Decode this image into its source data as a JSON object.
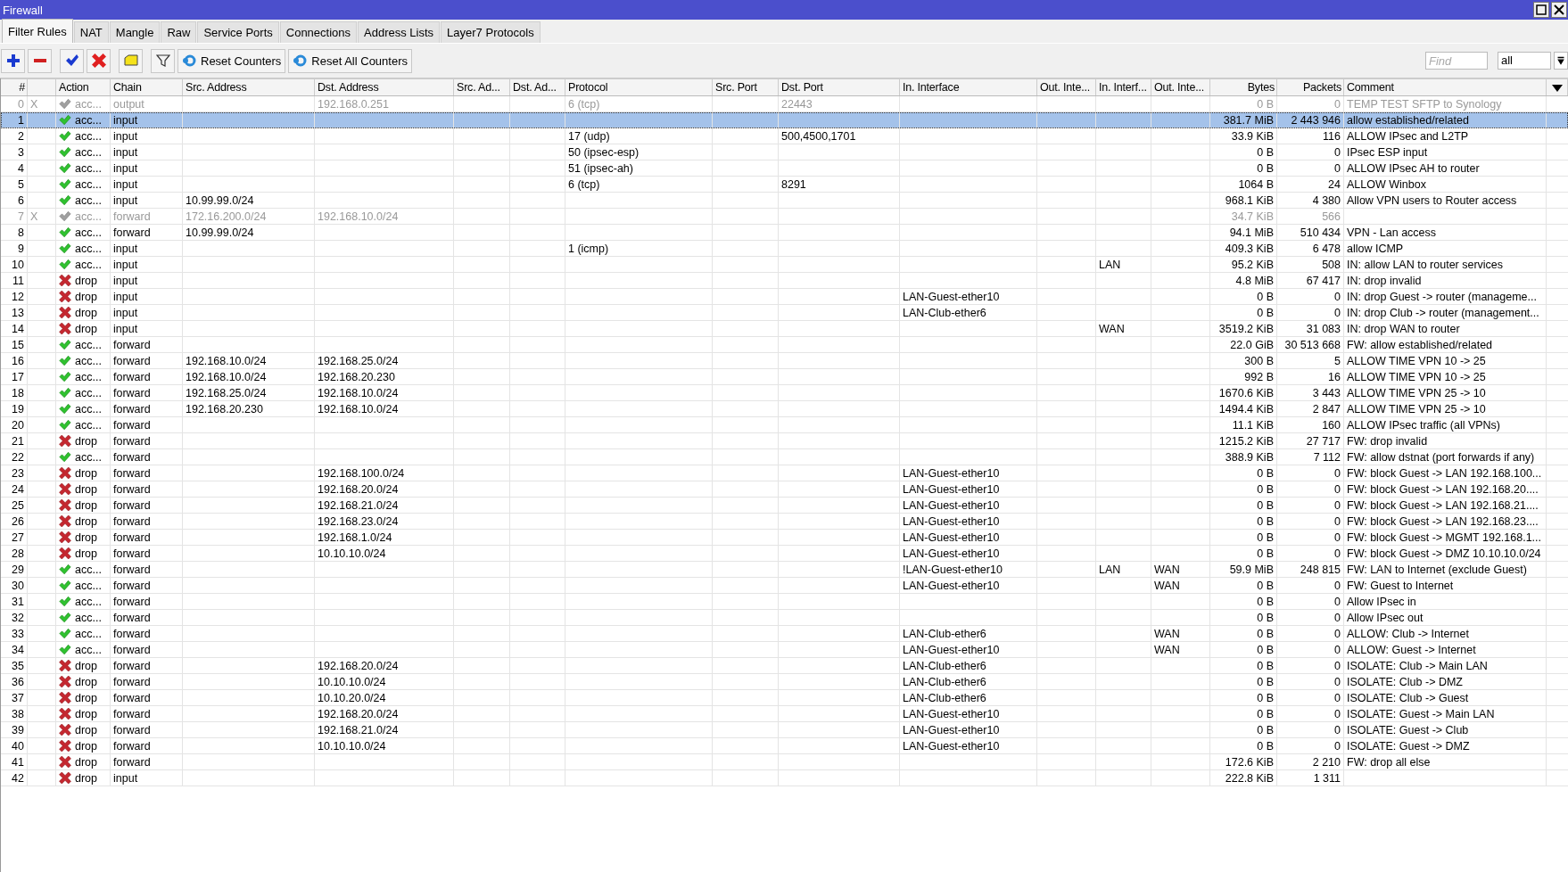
{
  "window": {
    "title": "Firewall"
  },
  "tabs": [
    {
      "label": "Filter Rules",
      "selected": true
    },
    {
      "label": "NAT",
      "selected": false
    },
    {
      "label": "Mangle",
      "selected": false
    },
    {
      "label": "Raw",
      "selected": false
    },
    {
      "label": "Service Ports",
      "selected": false
    },
    {
      "label": "Connections",
      "selected": false
    },
    {
      "label": "Address Lists",
      "selected": false
    },
    {
      "label": "Layer7 Protocols",
      "selected": false
    }
  ],
  "toolbar": {
    "buttons": [
      "Reset Counters",
      "Reset All Counters"
    ],
    "find": {
      "placeholder": "Find"
    },
    "filter_select": "all"
  },
  "table": {
    "columns": [
      "#",
      "",
      "Action",
      "Chain",
      "Src. Address",
      "Dst. Address",
      "Src. Ad...",
      "Dst. Ad...",
      "Protocol",
      "Src. Port",
      "Dst. Port",
      "In. Interface",
      "Out. Inte...",
      "In. Interf...",
      "Out. Inte...",
      "Bytes",
      "Packets",
      "Comment"
    ],
    "rows": [
      {
        "num": "0",
        "flag": "X",
        "disabled": true,
        "selected": false,
        "kind": "accept",
        "action": "acc...",
        "chain": "output",
        "dst_address": "192.168.0.251",
        "protocol": "6 (tcp)",
        "dst_port": "22443",
        "bytes": "0 B",
        "packets": "0",
        "comment": "TEMP TEST SFTP to Synology"
      },
      {
        "num": "1",
        "disabled": false,
        "selected": true,
        "kind": "accept",
        "action": "acc...",
        "chain": "input",
        "bytes": "381.7 MiB",
        "packets": "2 443 946",
        "comment": "allow established/related"
      },
      {
        "num": "2",
        "disabled": false,
        "selected": false,
        "kind": "accept",
        "action": "acc...",
        "chain": "input",
        "protocol": "17 (udp)",
        "dst_port": "500,4500,1701",
        "bytes": "33.9 KiB",
        "packets": "116",
        "comment": "ALLOW IPsec and L2TP"
      },
      {
        "num": "3",
        "disabled": false,
        "selected": false,
        "kind": "accept",
        "action": "acc...",
        "chain": "input",
        "protocol": "50 (ipsec-esp)",
        "bytes": "0 B",
        "packets": "0",
        "comment": "IPsec ESP input"
      },
      {
        "num": "4",
        "disabled": false,
        "selected": false,
        "kind": "accept",
        "action": "acc...",
        "chain": "input",
        "protocol": "51 (ipsec-ah)",
        "bytes": "0 B",
        "packets": "0",
        "comment": "ALLOW IPsec AH to router"
      },
      {
        "num": "5",
        "disabled": false,
        "selected": false,
        "kind": "accept",
        "action": "acc...",
        "chain": "input",
        "protocol": "6 (tcp)",
        "dst_port": "8291",
        "bytes": "1064 B",
        "packets": "24",
        "comment": "ALLOW Winbox"
      },
      {
        "num": "6",
        "disabled": false,
        "selected": false,
        "kind": "accept",
        "action": "acc...",
        "chain": "input",
        "src_address": "10.99.99.0/24",
        "bytes": "968.1 KiB",
        "packets": "4 380",
        "comment": "Allow VPN users to Router access"
      },
      {
        "num": "7",
        "flag": "X",
        "disabled": true,
        "selected": false,
        "kind": "accept",
        "action": "acc...",
        "chain": "forward",
        "src_address": "172.16.200.0/24",
        "dst_address": "192.168.10.0/24",
        "bytes": "34.7 KiB",
        "packets": "566"
      },
      {
        "num": "8",
        "disabled": false,
        "selected": false,
        "kind": "accept",
        "action": "acc...",
        "chain": "forward",
        "src_address": "10.99.99.0/24",
        "bytes": "94.1 MiB",
        "packets": "510 434",
        "comment": "VPN - Lan access"
      },
      {
        "num": "9",
        "disabled": false,
        "selected": false,
        "kind": "accept",
        "action": "acc...",
        "chain": "input",
        "protocol": "1 (icmp)",
        "bytes": "409.3 KiB",
        "packets": "6 478",
        "comment": "allow ICMP"
      },
      {
        "num": "10",
        "disabled": false,
        "selected": false,
        "kind": "accept",
        "action": "acc...",
        "chain": "input",
        "in_interface_list": "LAN",
        "bytes": "95.2 KiB",
        "packets": "508",
        "comment": "IN: allow LAN to router services"
      },
      {
        "num": "11",
        "disabled": false,
        "selected": false,
        "kind": "drop",
        "action": "drop",
        "chain": "input",
        "bytes": "4.8 MiB",
        "packets": "67 417",
        "comment": "IN: drop invalid"
      },
      {
        "num": "12",
        "disabled": false,
        "selected": false,
        "kind": "drop",
        "action": "drop",
        "chain": "input",
        "in_interface": "LAN-Guest-ether10",
        "bytes": "0 B",
        "packets": "0",
        "comment": "IN: drop Guest -> router (manageme..."
      },
      {
        "num": "13",
        "disabled": false,
        "selected": false,
        "kind": "drop",
        "action": "drop",
        "chain": "input",
        "in_interface": "LAN-Club-ether6",
        "bytes": "0 B",
        "packets": "0",
        "comment": "IN: drop Club -> router (management..."
      },
      {
        "num": "14",
        "disabled": false,
        "selected": false,
        "kind": "drop",
        "action": "drop",
        "chain": "input",
        "in_interface_list": "WAN",
        "bytes": "3519.2 KiB",
        "packets": "31 083",
        "comment": "IN: drop WAN to router"
      },
      {
        "num": "15",
        "disabled": false,
        "selected": false,
        "kind": "accept",
        "action": "acc...",
        "chain": "forward",
        "bytes": "22.0 GiB",
        "packets": "30 513 668",
        "comment": "FW: allow established/related"
      },
      {
        "num": "16",
        "disabled": false,
        "selected": false,
        "kind": "accept",
        "action": "acc...",
        "chain": "forward",
        "src_address": "192.168.10.0/24",
        "dst_address": "192.168.25.0/24",
        "bytes": "300 B",
        "packets": "5",
        "comment": "ALLOW TIME VPN 10 -> 25"
      },
      {
        "num": "17",
        "disabled": false,
        "selected": false,
        "kind": "accept",
        "action": "acc...",
        "chain": "forward",
        "src_address": "192.168.10.0/24",
        "dst_address": "192.168.20.230",
        "bytes": "992 B",
        "packets": "16",
        "comment": "ALLOW TIME VPN 10 -> 25"
      },
      {
        "num": "18",
        "disabled": false,
        "selected": false,
        "kind": "accept",
        "action": "acc...",
        "chain": "forward",
        "src_address": "192.168.25.0/24",
        "dst_address": "192.168.10.0/24",
        "bytes": "1670.6 KiB",
        "packets": "3 443",
        "comment": "ALLOW TIME VPN 25 -> 10"
      },
      {
        "num": "19",
        "disabled": false,
        "selected": false,
        "kind": "accept",
        "action": "acc...",
        "chain": "forward",
        "src_address": "192.168.20.230",
        "dst_address": "192.168.10.0/24",
        "bytes": "1494.4 KiB",
        "packets": "2 847",
        "comment": "ALLOW TIME VPN 25 -> 10"
      },
      {
        "num": "20",
        "disabled": false,
        "selected": false,
        "kind": "accept",
        "action": "acc...",
        "chain": "forward",
        "bytes": "11.1 KiB",
        "packets": "160",
        "comment": "ALLOW IPsec traffic (all VPNs)"
      },
      {
        "num": "21",
        "disabled": false,
        "selected": false,
        "kind": "drop",
        "action": "drop",
        "chain": "forward",
        "bytes": "1215.2 KiB",
        "packets": "27 717",
        "comment": "FW: drop invalid"
      },
      {
        "num": "22",
        "disabled": false,
        "selected": false,
        "kind": "accept",
        "action": "acc...",
        "chain": "forward",
        "bytes": "388.9 KiB",
        "packets": "7 112",
        "comment": "FW: allow dstnat (port forwards if any)"
      },
      {
        "num": "23",
        "disabled": false,
        "selected": false,
        "kind": "drop",
        "action": "drop",
        "chain": "forward",
        "dst_address": "192.168.100.0/24",
        "in_interface": "LAN-Guest-ether10",
        "bytes": "0 B",
        "packets": "0",
        "comment": "FW: block Guest -> LAN 192.168.100..."
      },
      {
        "num": "24",
        "disabled": false,
        "selected": false,
        "kind": "drop",
        "action": "drop",
        "chain": "forward",
        "dst_address": "192.168.20.0/24",
        "in_interface": "LAN-Guest-ether10",
        "bytes": "0 B",
        "packets": "0",
        "comment": "FW: block Guest -> LAN 192.168.20...."
      },
      {
        "num": "25",
        "disabled": false,
        "selected": false,
        "kind": "drop",
        "action": "drop",
        "chain": "forward",
        "dst_address": "192.168.21.0/24",
        "in_interface": "LAN-Guest-ether10",
        "bytes": "0 B",
        "packets": "0",
        "comment": "FW: block Guest -> LAN 192.168.21...."
      },
      {
        "num": "26",
        "disabled": false,
        "selected": false,
        "kind": "drop",
        "action": "drop",
        "chain": "forward",
        "dst_address": "192.168.23.0/24",
        "in_interface": "LAN-Guest-ether10",
        "bytes": "0 B",
        "packets": "0",
        "comment": "FW: block Guest -> LAN 192.168.23...."
      },
      {
        "num": "27",
        "disabled": false,
        "selected": false,
        "kind": "drop",
        "action": "drop",
        "chain": "forward",
        "dst_address": "192.168.1.0/24",
        "in_interface": "LAN-Guest-ether10",
        "bytes": "0 B",
        "packets": "0",
        "comment": "FW: block Guest -> MGMT 192.168.1..."
      },
      {
        "num": "28",
        "disabled": false,
        "selected": false,
        "kind": "drop",
        "action": "drop",
        "chain": "forward",
        "dst_address": "10.10.10.0/24",
        "in_interface": "LAN-Guest-ether10",
        "bytes": "0 B",
        "packets": "0",
        "comment": "FW: block Guest -> DMZ 10.10.10.0/24"
      },
      {
        "num": "29",
        "disabled": false,
        "selected": false,
        "kind": "accept",
        "action": "acc...",
        "chain": "forward",
        "in_interface": "!LAN-Guest-ether10",
        "in_interface_list": "LAN",
        "out_interface_list": "WAN",
        "bytes": "59.9 MiB",
        "packets": "248 815",
        "comment": "FW: LAN to Internet (exclude Guest)"
      },
      {
        "num": "30",
        "disabled": false,
        "selected": false,
        "kind": "accept",
        "action": "acc...",
        "chain": "forward",
        "in_interface": "LAN-Guest-ether10",
        "out_interface_list": "WAN",
        "bytes": "0 B",
        "packets": "0",
        "comment": "FW: Guest to Internet"
      },
      {
        "num": "31",
        "disabled": false,
        "selected": false,
        "kind": "accept",
        "action": "acc...",
        "chain": "forward",
        "bytes": "0 B",
        "packets": "0",
        "comment": "Allow IPsec in"
      },
      {
        "num": "32",
        "disabled": false,
        "selected": false,
        "kind": "accept",
        "action": "acc...",
        "chain": "forward",
        "bytes": "0 B",
        "packets": "0",
        "comment": "Allow IPsec out"
      },
      {
        "num": "33",
        "disabled": false,
        "selected": false,
        "kind": "accept",
        "action": "acc...",
        "chain": "forward",
        "in_interface": "LAN-Club-ether6",
        "out_interface_list": "WAN",
        "bytes": "0 B",
        "packets": "0",
        "comment": "ALLOW: Club -> Internet"
      },
      {
        "num": "34",
        "disabled": false,
        "selected": false,
        "kind": "accept",
        "action": "acc...",
        "chain": "forward",
        "in_interface": "LAN-Guest-ether10",
        "out_interface_list": "WAN",
        "bytes": "0 B",
        "packets": "0",
        "comment": "ALLOW: Guest -> Internet"
      },
      {
        "num": "35",
        "disabled": false,
        "selected": false,
        "kind": "drop",
        "action": "drop",
        "chain": "forward",
        "dst_address": "192.168.20.0/24",
        "in_interface": "LAN-Club-ether6",
        "bytes": "0 B",
        "packets": "0",
        "comment": "ISOLATE: Club -> Main LAN"
      },
      {
        "num": "36",
        "disabled": false,
        "selected": false,
        "kind": "drop",
        "action": "drop",
        "chain": "forward",
        "dst_address": "10.10.10.0/24",
        "in_interface": "LAN-Club-ether6",
        "bytes": "0 B",
        "packets": "0",
        "comment": "ISOLATE: Club -> DMZ"
      },
      {
        "num": "37",
        "disabled": false,
        "selected": false,
        "kind": "drop",
        "action": "drop",
        "chain": "forward",
        "dst_address": "10.10.20.0/24",
        "in_interface": "LAN-Club-ether6",
        "bytes": "0 B",
        "packets": "0",
        "comment": "ISOLATE: Club -> Guest"
      },
      {
        "num": "38",
        "disabled": false,
        "selected": false,
        "kind": "drop",
        "action": "drop",
        "chain": "forward",
        "dst_address": "192.168.20.0/24",
        "in_interface": "LAN-Guest-ether10",
        "bytes": "0 B",
        "packets": "0",
        "comment": "ISOLATE: Guest -> Main LAN"
      },
      {
        "num": "39",
        "disabled": false,
        "selected": false,
        "kind": "drop",
        "action": "drop",
        "chain": "forward",
        "dst_address": "192.168.21.0/24",
        "in_interface": "LAN-Guest-ether10",
        "bytes": "0 B",
        "packets": "0",
        "comment": "ISOLATE: Guest -> Club"
      },
      {
        "num": "40",
        "disabled": false,
        "selected": false,
        "kind": "drop",
        "action": "drop",
        "chain": "forward",
        "dst_address": "10.10.10.0/24",
        "in_interface": "LAN-Guest-ether10",
        "bytes": "0 B",
        "packets": "0",
        "comment": "ISOLATE: Guest -> DMZ"
      },
      {
        "num": "41",
        "disabled": false,
        "selected": false,
        "kind": "drop",
        "action": "drop",
        "chain": "forward",
        "bytes": "172.6 KiB",
        "packets": "2 210",
        "comment": "FW: drop all else"
      },
      {
        "num": "42",
        "disabled": false,
        "selected": false,
        "kind": "drop",
        "action": "drop",
        "chain": "input",
        "bytes": "222.8 KiB",
        "packets": "1 311"
      }
    ]
  }
}
